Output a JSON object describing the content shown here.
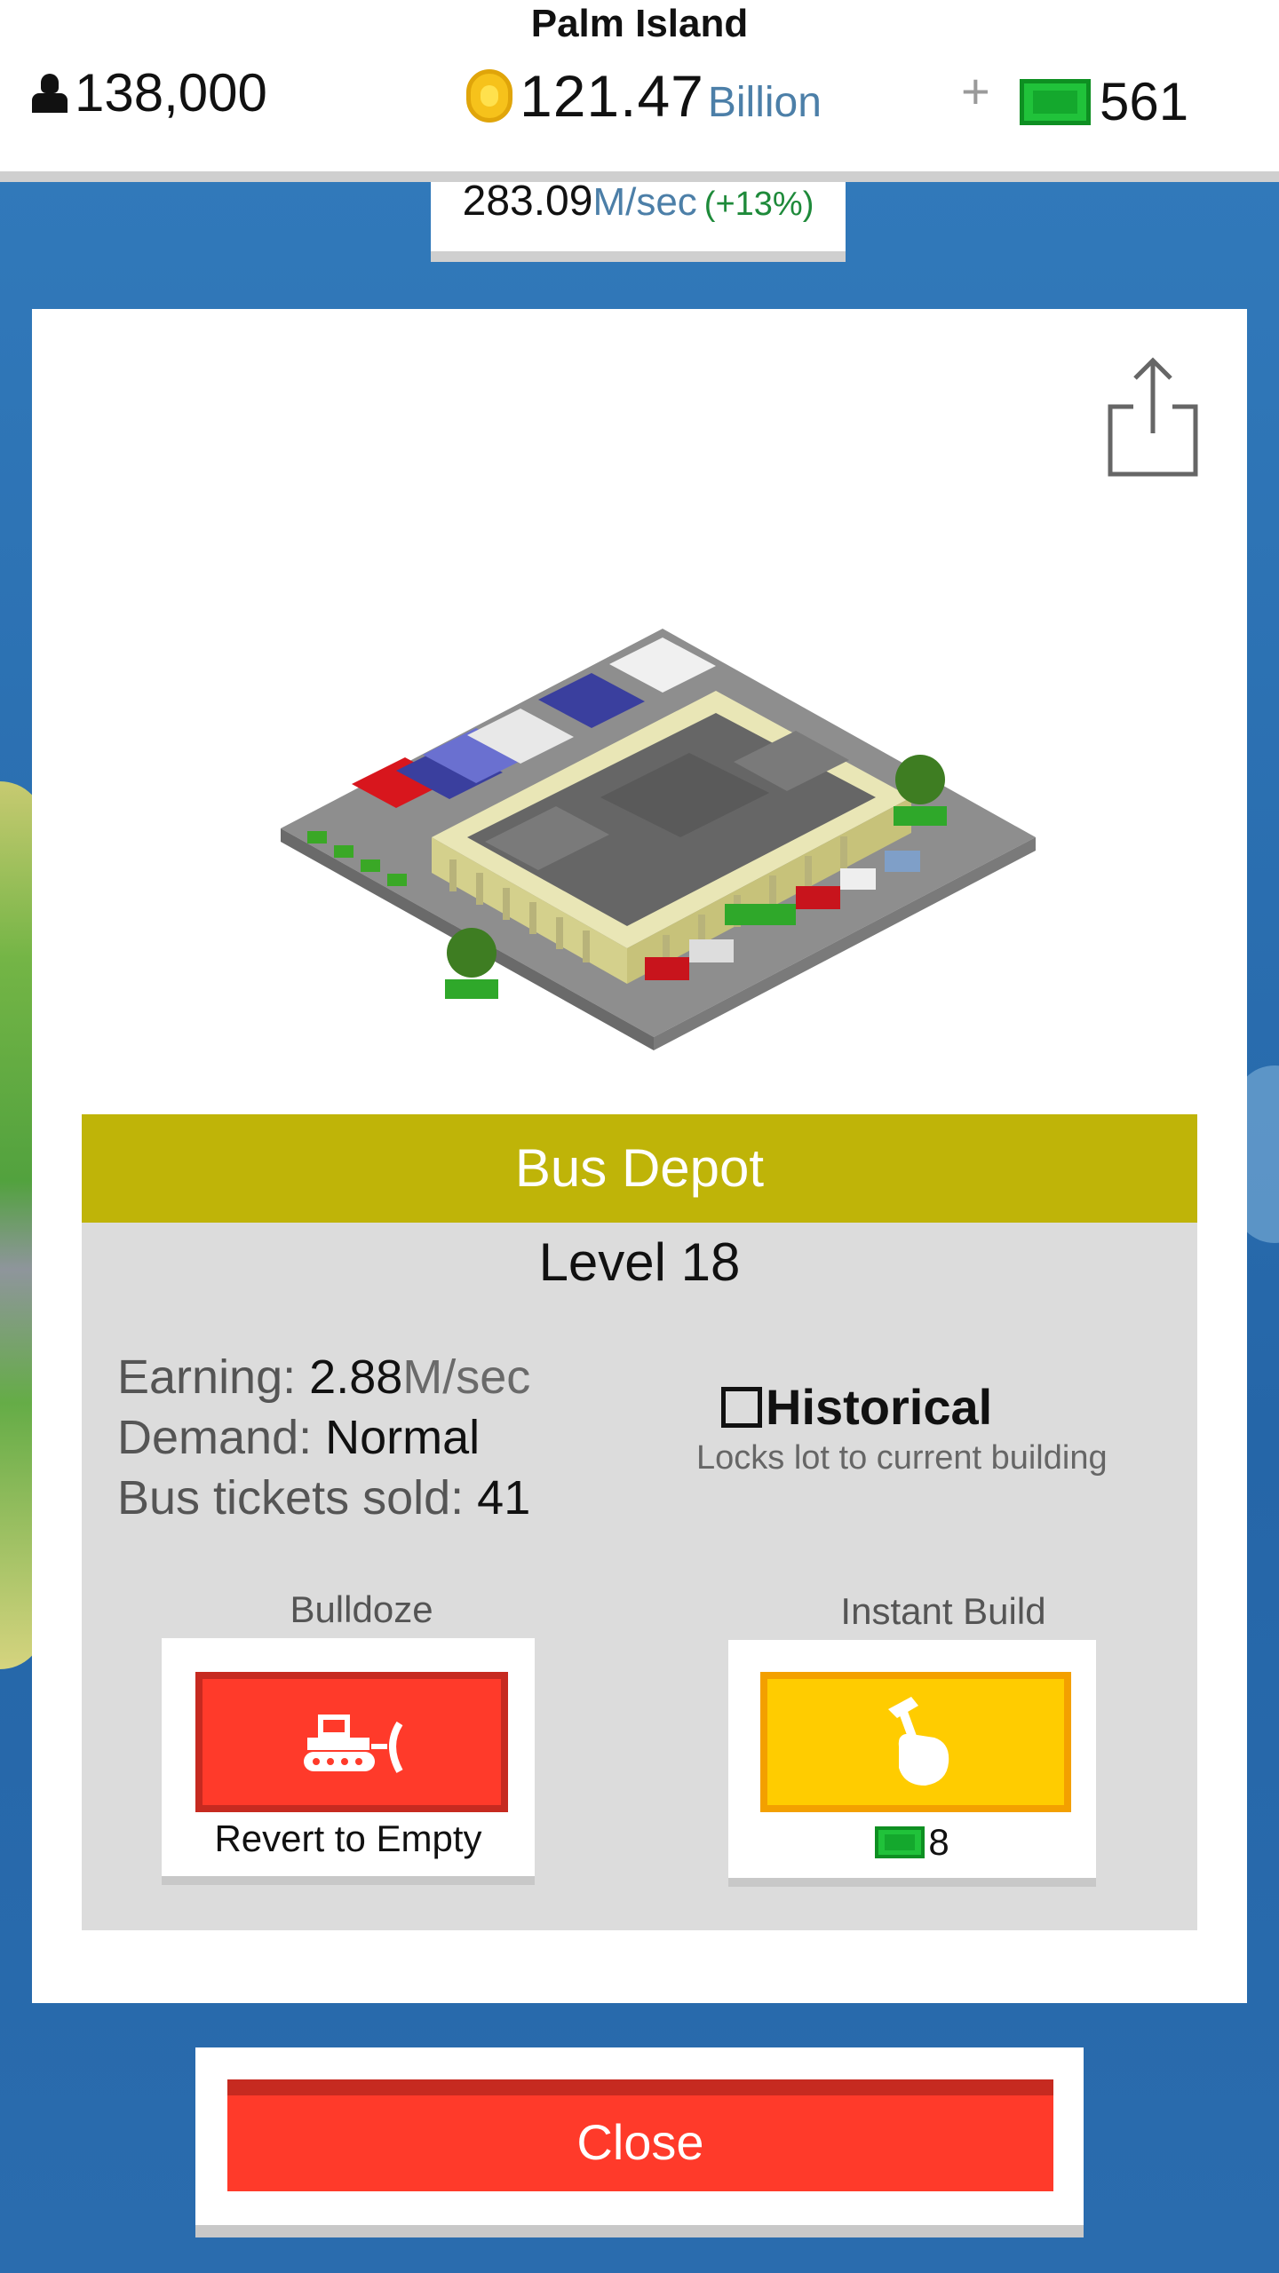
{
  "header": {
    "city_name": "Palm Island",
    "population": "138,000",
    "money_value": "121.47",
    "money_unit": "Billion",
    "plus": "+",
    "cash": "561"
  },
  "income": {
    "value": "283.09",
    "unit": "M/sec",
    "percent": "(+13%)"
  },
  "building": {
    "name": "Bus Depot",
    "level": "Level 18",
    "earning_label": "Earning:",
    "earning_value": "2.88",
    "earning_unit": "M/sec",
    "demand_label": "Demand:",
    "demand_value": "Normal",
    "tickets_label": "Bus tickets sold:",
    "tickets_value": "41"
  },
  "historical": {
    "label": "Historical",
    "sub": "Locks lot to current building",
    "checked": false
  },
  "actions": {
    "bulldoze_label": "Bulldoze",
    "bulldoze_text": "Revert to Empty",
    "instant_label": "Instant Build",
    "instant_cost": "8"
  },
  "close_label": "Close",
  "icons": {
    "population": "person-icon",
    "money": "coin-icon",
    "cash": "cash-bill-icon",
    "share": "share-icon",
    "bulldoze": "bulldozer-icon",
    "instant": "hammer-hand-icon"
  }
}
